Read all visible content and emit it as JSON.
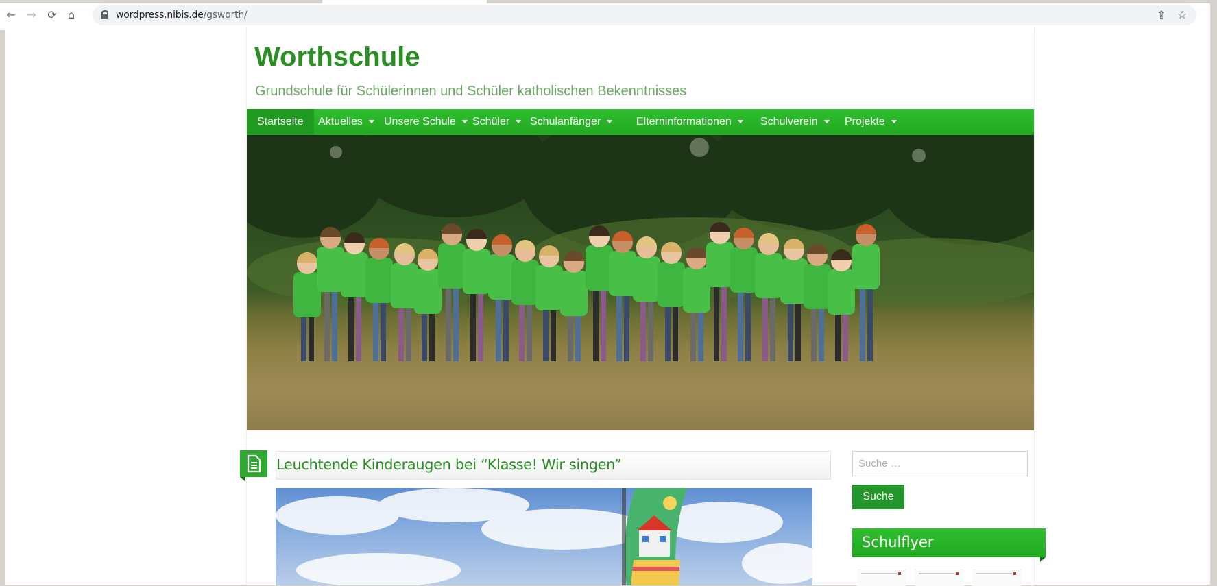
{
  "browser": {
    "url_host": "wordpress.nibis.de",
    "url_path": "/gsworth/",
    "back_icon": "arrow-left-icon",
    "forward_icon": "arrow-right-icon",
    "reload_icon": "reload-icon",
    "home_icon": "home-icon",
    "share_icon": "share-icon",
    "bookmark_icon": "star-icon"
  },
  "site": {
    "title": "Worthschule",
    "tagline": "Grundschule für Schülerinnen und Schüler katholischen Bekenntnisses",
    "accent_color": "#2ea82e",
    "title_color": "#2a8f22"
  },
  "menu": {
    "items": [
      {
        "label": "Startseite",
        "active": true,
        "has_dropdown": false
      },
      {
        "label": "Aktuelles",
        "has_dropdown": true
      },
      {
        "label": "Unsere Schule",
        "has_dropdown": true
      },
      {
        "label": "Schüler",
        "has_dropdown": true
      },
      {
        "label": "Schulanfänger",
        "has_dropdown": true
      },
      {
        "label": "Elterninformationen",
        "has_dropdown": true
      },
      {
        "label": "Schulverein",
        "has_dropdown": true
      },
      {
        "label": "Projekte",
        "has_dropdown": true
      }
    ]
  },
  "post": {
    "title": "Leuchtende Kinderaugen bei “Klasse! Wir singen”",
    "icon": "document-icon"
  },
  "sidebar": {
    "search_placeholder": "Suche …",
    "search_button": "Suche",
    "widget_title": "Schulflyer"
  }
}
